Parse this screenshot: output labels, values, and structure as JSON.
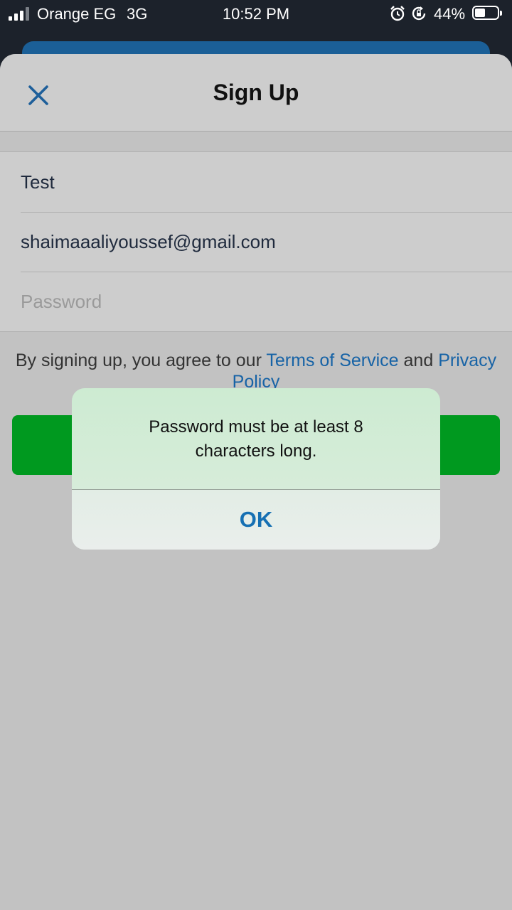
{
  "status_bar": {
    "carrier": "Orange EG",
    "network": "3G",
    "time": "10:52 PM",
    "battery_percent": "44%",
    "icons": [
      "signal-icon",
      "alarm-icon",
      "rotation-lock-icon",
      "battery-icon"
    ]
  },
  "header": {
    "title": "Sign Up",
    "close_icon": "close-icon"
  },
  "form": {
    "name_value": "Test",
    "email_value": "shaimaaaliyoussef@gmail.com",
    "password_placeholder": "Password"
  },
  "terms": {
    "prefix": "By signing up, you agree to our ",
    "terms_link": "Terms of Service",
    "middle": " and ",
    "privacy_link": "Privacy Policy"
  },
  "alert": {
    "message_line1": "Password must be at least 8",
    "message_line2": "characters long.",
    "ok_label": "OK"
  },
  "colors": {
    "accent": "#1670b3",
    "primary_button": "#00991f",
    "link": "#1763a6"
  }
}
